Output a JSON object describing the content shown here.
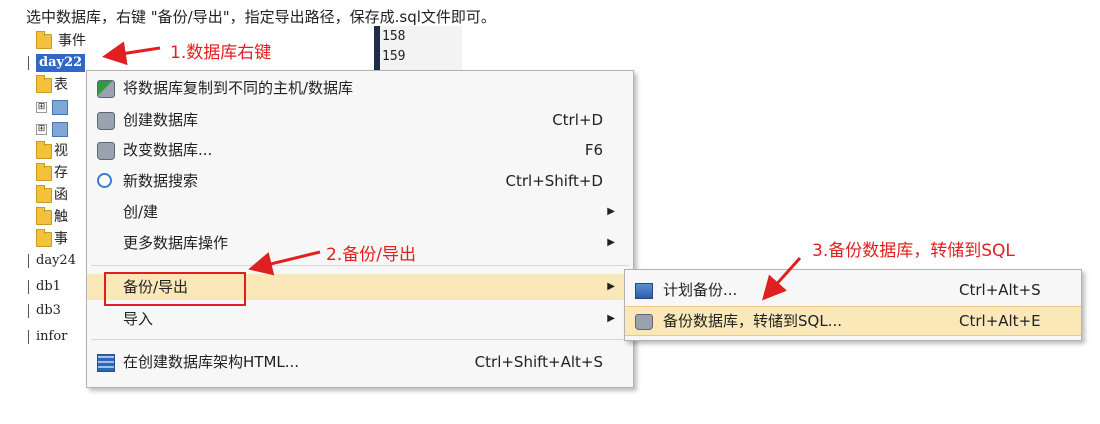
{
  "intro_text": "选中数据库，右键 \"备份/导出\"，指定导出路径，保存成.sql文件即可。",
  "tree": {
    "events_top": "事件",
    "selected_db": "day22",
    "partial_labels": [
      "表",
      "视",
      "存",
      "函",
      "触",
      "事"
    ],
    "other_dbs": [
      "day24",
      "db1",
      "db3",
      "infor"
    ],
    "expand_glyph": "⊞"
  },
  "line_numbers": [
    "158",
    "159"
  ],
  "menu": {
    "items": [
      {
        "label": "将数据库复制到不同的主机/数据库",
        "shortcut": "",
        "icon": "copy-db-icon"
      },
      {
        "label": "创建数据库",
        "shortcut": "Ctrl+D",
        "icon": "create-db-icon"
      },
      {
        "label": "改变数据库...",
        "shortcut": "F6",
        "icon": "alter-db-icon"
      },
      {
        "label": "新数据搜索",
        "shortcut": "Ctrl+Shift+D",
        "icon": "search-icon"
      },
      {
        "label": "创/建",
        "shortcut": "",
        "icon": ""
      },
      {
        "label": "更多数据库操作",
        "shortcut": "",
        "icon": ""
      },
      {
        "label": "备份/导出",
        "shortcut": "",
        "icon": ""
      },
      {
        "label": "导入",
        "shortcut": "",
        "icon": ""
      },
      {
        "label": "在创建数据库架构HTML...",
        "shortcut": "Ctrl+Shift+Alt+S",
        "icon": "schema-html-icon"
      }
    ],
    "submenu_arrow": "▶"
  },
  "submenu": {
    "items": [
      {
        "label": "计划备份...",
        "shortcut": "Ctrl+Alt+S",
        "icon": "schedule-backup-icon"
      },
      {
        "label": "备份数据库，转储到SQL...",
        "shortcut": "Ctrl+Alt+E",
        "icon": "backup-db-icon"
      }
    ]
  },
  "annotations": {
    "step1": "1.数据库右键",
    "step2": "2.备份/导出",
    "step3": "3.备份数据库，转储到SQL"
  },
  "colors": {
    "annotation": "#e02020",
    "selection": "#3168c6",
    "highlight": "#fbe8b9"
  }
}
